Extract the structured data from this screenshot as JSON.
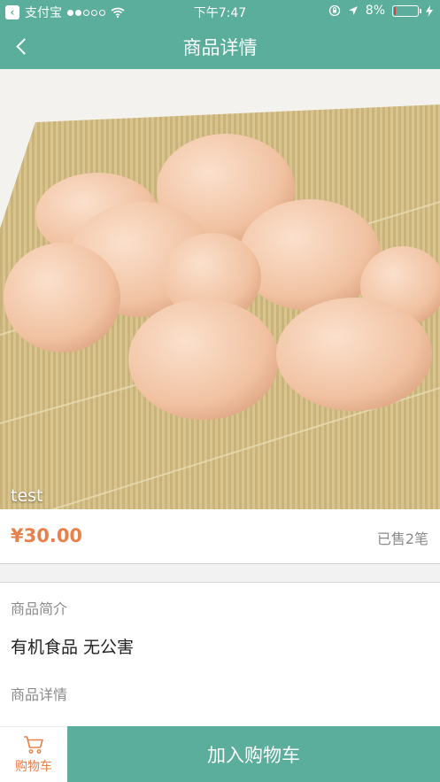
{
  "status_bar": {
    "carrier": "支付宝",
    "time": "下午7:47",
    "battery": "8%",
    "battery_level": 0.08,
    "signal_dots": [
      true,
      true,
      false,
      false,
      false
    ]
  },
  "nav": {
    "title": "商品详情"
  },
  "product": {
    "name": "test",
    "price": "¥30.00",
    "sold": "已售2笔",
    "intro_label": "商品简介",
    "intro_text": "有机食品 无公害",
    "details_label": "商品详情"
  },
  "bottom_bar": {
    "cart_label": "购物车",
    "add_to_cart_label": "加入购物车"
  },
  "colors": {
    "brand": "#5aae9b",
    "accent": "#e8804a",
    "battery_low": "#e0393a"
  },
  "icons": {
    "back": "chevron-left-icon",
    "cart": "shopping-cart-icon",
    "wifi": "wifi-icon",
    "location": "location-arrow-icon",
    "lock": "orientation-lock-icon",
    "charging": "charging-bolt-icon"
  }
}
